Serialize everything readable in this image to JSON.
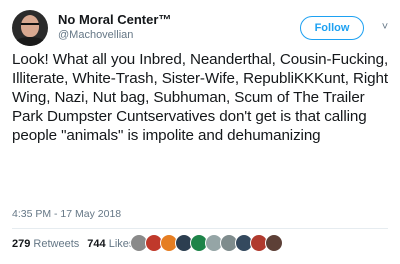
{
  "author": {
    "name": "No Moral Center™",
    "handle": "@Machovellian"
  },
  "actions": {
    "follow_label": "Follow",
    "more_glyph": "˅"
  },
  "tweet": {
    "text": "Look!  What all you Inbred, Neanderthal, Cousin-Fucking, Illiterate, White-Trash, Sister-Wife, RepubliKKKunt, Right Wing, Nazi, Nut bag, Subhuman, Scum of The Trailer Park Dumpster Cuntservatives don't get is that calling people \"animals\" is impolite and dehumanizing",
    "timestamp": "4:35 PM - 17 May 2018"
  },
  "stats": {
    "retweets_count": "279",
    "retweets_label": "Retweets",
    "likes_count": "744",
    "likes_label": "Likes"
  },
  "likers": {
    "avatar_colors": [
      "#8a8a8a",
      "#c0392b",
      "#e67e22",
      "#2c3e50",
      "#1e8449",
      "#95a5a6",
      "#7f8c8d",
      "#34495e",
      "#b03a2e",
      "#5d4037"
    ]
  },
  "colors": {
    "accent": "#1da1f2",
    "text": "#14171a",
    "muted": "#657786"
  }
}
